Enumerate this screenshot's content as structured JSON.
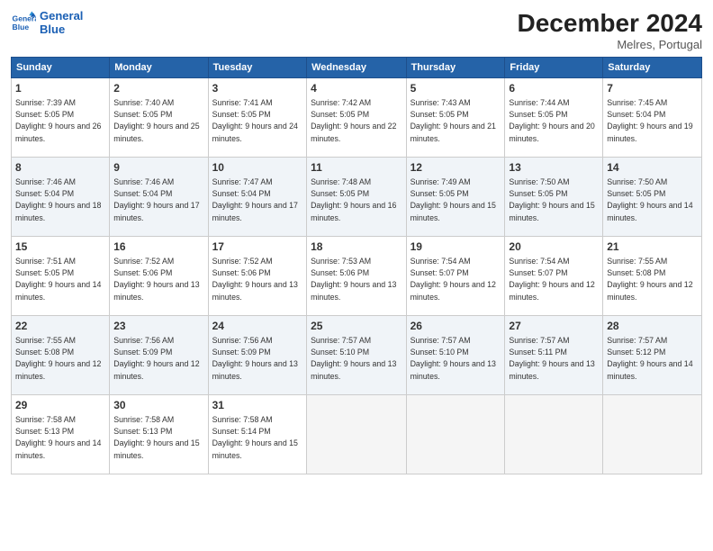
{
  "header": {
    "logo_line1": "General",
    "logo_line2": "Blue",
    "month": "December 2024",
    "location": "Melres, Portugal"
  },
  "days_of_week": [
    "Sunday",
    "Monday",
    "Tuesday",
    "Wednesday",
    "Thursday",
    "Friday",
    "Saturday"
  ],
  "weeks": [
    [
      {
        "day": 1,
        "sunrise": "7:39 AM",
        "sunset": "5:05 PM",
        "daylight": "9 hours and 26 minutes."
      },
      {
        "day": 2,
        "sunrise": "7:40 AM",
        "sunset": "5:05 PM",
        "daylight": "9 hours and 25 minutes."
      },
      {
        "day": 3,
        "sunrise": "7:41 AM",
        "sunset": "5:05 PM",
        "daylight": "9 hours and 24 minutes."
      },
      {
        "day": 4,
        "sunrise": "7:42 AM",
        "sunset": "5:05 PM",
        "daylight": "9 hours and 22 minutes."
      },
      {
        "day": 5,
        "sunrise": "7:43 AM",
        "sunset": "5:05 PM",
        "daylight": "9 hours and 21 minutes."
      },
      {
        "day": 6,
        "sunrise": "7:44 AM",
        "sunset": "5:05 PM",
        "daylight": "9 hours and 20 minutes."
      },
      {
        "day": 7,
        "sunrise": "7:45 AM",
        "sunset": "5:04 PM",
        "daylight": "9 hours and 19 minutes."
      }
    ],
    [
      {
        "day": 8,
        "sunrise": "7:46 AM",
        "sunset": "5:04 PM",
        "daylight": "9 hours and 18 minutes."
      },
      {
        "day": 9,
        "sunrise": "7:46 AM",
        "sunset": "5:04 PM",
        "daylight": "9 hours and 17 minutes."
      },
      {
        "day": 10,
        "sunrise": "7:47 AM",
        "sunset": "5:04 PM",
        "daylight": "9 hours and 17 minutes."
      },
      {
        "day": 11,
        "sunrise": "7:48 AM",
        "sunset": "5:05 PM",
        "daylight": "9 hours and 16 minutes."
      },
      {
        "day": 12,
        "sunrise": "7:49 AM",
        "sunset": "5:05 PM",
        "daylight": "9 hours and 15 minutes."
      },
      {
        "day": 13,
        "sunrise": "7:50 AM",
        "sunset": "5:05 PM",
        "daylight": "9 hours and 15 minutes."
      },
      {
        "day": 14,
        "sunrise": "7:50 AM",
        "sunset": "5:05 PM",
        "daylight": "9 hours and 14 minutes."
      }
    ],
    [
      {
        "day": 15,
        "sunrise": "7:51 AM",
        "sunset": "5:05 PM",
        "daylight": "9 hours and 14 minutes."
      },
      {
        "day": 16,
        "sunrise": "7:52 AM",
        "sunset": "5:06 PM",
        "daylight": "9 hours and 13 minutes."
      },
      {
        "day": 17,
        "sunrise": "7:52 AM",
        "sunset": "5:06 PM",
        "daylight": "9 hours and 13 minutes."
      },
      {
        "day": 18,
        "sunrise": "7:53 AM",
        "sunset": "5:06 PM",
        "daylight": "9 hours and 13 minutes."
      },
      {
        "day": 19,
        "sunrise": "7:54 AM",
        "sunset": "5:07 PM",
        "daylight": "9 hours and 12 minutes."
      },
      {
        "day": 20,
        "sunrise": "7:54 AM",
        "sunset": "5:07 PM",
        "daylight": "9 hours and 12 minutes."
      },
      {
        "day": 21,
        "sunrise": "7:55 AM",
        "sunset": "5:08 PM",
        "daylight": "9 hours and 12 minutes."
      }
    ],
    [
      {
        "day": 22,
        "sunrise": "7:55 AM",
        "sunset": "5:08 PM",
        "daylight": "9 hours and 12 minutes."
      },
      {
        "day": 23,
        "sunrise": "7:56 AM",
        "sunset": "5:09 PM",
        "daylight": "9 hours and 12 minutes."
      },
      {
        "day": 24,
        "sunrise": "7:56 AM",
        "sunset": "5:09 PM",
        "daylight": "9 hours and 13 minutes."
      },
      {
        "day": 25,
        "sunrise": "7:57 AM",
        "sunset": "5:10 PM",
        "daylight": "9 hours and 13 minutes."
      },
      {
        "day": 26,
        "sunrise": "7:57 AM",
        "sunset": "5:10 PM",
        "daylight": "9 hours and 13 minutes."
      },
      {
        "day": 27,
        "sunrise": "7:57 AM",
        "sunset": "5:11 PM",
        "daylight": "9 hours and 13 minutes."
      },
      {
        "day": 28,
        "sunrise": "7:57 AM",
        "sunset": "5:12 PM",
        "daylight": "9 hours and 14 minutes."
      }
    ],
    [
      {
        "day": 29,
        "sunrise": "7:58 AM",
        "sunset": "5:13 PM",
        "daylight": "9 hours and 14 minutes."
      },
      {
        "day": 30,
        "sunrise": "7:58 AM",
        "sunset": "5:13 PM",
        "daylight": "9 hours and 15 minutes."
      },
      {
        "day": 31,
        "sunrise": "7:58 AM",
        "sunset": "5:14 PM",
        "daylight": "9 hours and 15 minutes."
      },
      null,
      null,
      null,
      null
    ]
  ]
}
